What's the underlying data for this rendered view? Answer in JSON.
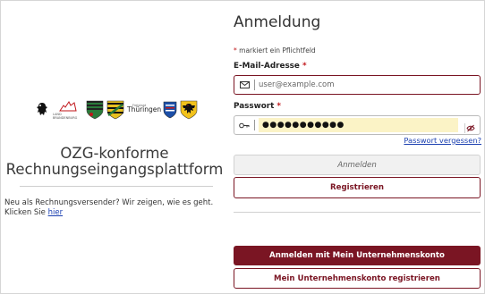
{
  "left": {
    "logos": [
      "berlin-bear-crest",
      "land-brandenburg",
      "saxony-anhalt-crest",
      "saxony-crest",
      "thueringen",
      "germany-eagle"
    ],
    "logo_text": {
      "brandenburg_small": "LAND BRANDENBURG",
      "thueringen_sup": "Freistaat",
      "thueringen": "Thüringen"
    },
    "title_line1": "OZG-konforme",
    "title_line2": "Rechnungseingangsplattform",
    "hint_text": "Neu als Rechnungsversender? Wir zeigen, wie es geht. Klicken Sie ",
    "hint_link": "hier"
  },
  "login": {
    "heading": "Anmeldung",
    "required_star": "*",
    "required_note": "markiert ein Pflichtfeld",
    "email_label": "E-Mail-Adresse",
    "email_placeholder": "user@example.com",
    "password_label": "Passwort",
    "password_value": "●●●●●●●●●●●",
    "forgot_link": "Passwort vergessen?",
    "login_button": "Anmelden",
    "register_button": "Registrieren",
    "business_login_button": "Anmelden mit Mein Unternehmenskonto",
    "business_register_button": "Mein Unternehmenskonto registrieren"
  },
  "colors": {
    "accent": "#7a1523",
    "link": "#1a3fb0",
    "required": "#c0161a",
    "password_fill": "#fbf3c6"
  },
  "icons": {
    "email": "envelope-icon",
    "password": "key-icon",
    "visibility": "eye-slash-icon"
  }
}
